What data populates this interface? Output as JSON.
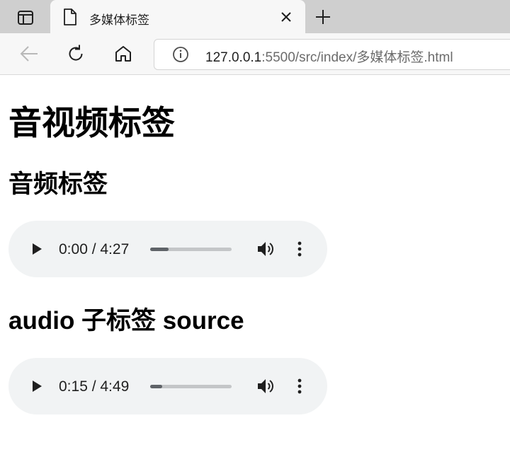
{
  "browser": {
    "tab": {
      "title": "多媒体标签",
      "close_icon": "close-icon",
      "doc_icon": "document-icon"
    },
    "tab_actions_icon": "tab-actions-icon",
    "new_tab_icon": "plus-icon",
    "toolbar": {
      "back_icon": "arrow-left-icon",
      "reload_icon": "reload-icon",
      "home_icon": "home-icon",
      "info_icon": "info-icon",
      "url_host": "127.0.0.1",
      "url_rest": ":5500/src/index/多媒体标签.html"
    }
  },
  "page": {
    "heading": "音视频标签",
    "sections": [
      {
        "title": "音频标签",
        "player": {
          "time": "0:00 / 4:27",
          "progress": 0.23
        }
      },
      {
        "title": "audio 子标签 source",
        "player": {
          "time": "0:15 / 4:49",
          "progress": 0.15
        }
      }
    ]
  },
  "colors": {
    "player_bg": "#f1f3f4",
    "progress_fill": "#5f6368",
    "progress_track": "#c4c6c8",
    "tabstrip_bg": "#cfcfcf",
    "toolbar_bg": "#f7f7f7"
  }
}
